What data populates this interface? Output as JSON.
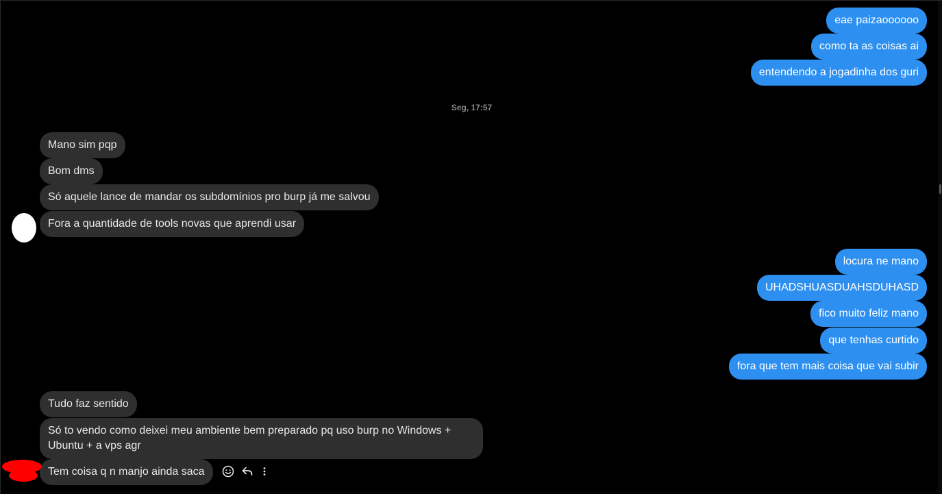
{
  "sent_group_1": [
    "eae paizaoooooo",
    "como ta as coisas ai",
    "entendendo a jogadinha dos guri"
  ],
  "timestamp": "Seg, 17:57",
  "received_group_1": [
    "Mano sim pqp",
    "Bom dms",
    "Só aquele lance de mandar os subdomínios pro burp já me salvou",
    "Fora a quantidade de tools novas que aprendi usar"
  ],
  "sent_group_2": [
    "locura ne mano",
    "UHADSHUASDUAHSDUHASD",
    "fico muito feliz mano",
    "que tenhas curtido",
    "fora que tem mais coisa que vai subir"
  ],
  "received_group_2": [
    "Tudo faz sentido",
    "Só to vendo como deixei meu ambiente bem preparado pq uso burp no Windows + Ubuntu + a vps agr",
    "Tem coisa q n manjo ainda saca"
  ],
  "icons": {
    "react": "smiley-icon",
    "reply": "reply-icon",
    "more": "more-vertical-icon"
  },
  "colors": {
    "background": "#000000",
    "sent_bubble": "#2d8ff0",
    "received_bubble": "#2f2f2f",
    "timestamp": "#8a8a8a"
  }
}
